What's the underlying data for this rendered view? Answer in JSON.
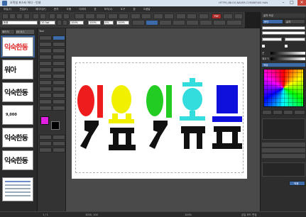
{
  "titlebar": {
    "title": "오락실 포스터 하다 - 인쇄",
    "url": "HTTPS://BLOG.NAVER.COM/INFIXIS HAN",
    "min": "–",
    "max": "□",
    "close": "×"
  },
  "menu": [
    "파일(F)",
    "편집(E)",
    "페이지(P)",
    "문자",
    "도형",
    "이미지",
    "표",
    "보기(V)",
    "도구",
    "창",
    "도움말"
  ],
  "toolbar": {
    "font_name": "돋움",
    "font_size": "10.5pt",
    "zoom": "100%",
    "field_a": "100%",
    "field_b": "0%",
    "field_c": "100%",
    "pdf_label": "PDF"
  },
  "pages": {
    "label": "페이지",
    "tab": "A4 6:1",
    "thumb_1": "익숙한동",
    "thumb_2": "워아",
    "thumb_3": "익숙한동",
    "thumb_4": "익숙한동",
    "thumb_5": "9,000",
    "thumb_6": "익숙한동"
  },
  "tools": {
    "label": "Tool"
  },
  "canvas": {
    "letters": [
      {
        "top": "이",
        "bottom": "ㅈ",
        "color": "#ee1c1c"
      },
      {
        "top": "요",
        "bottom": "ㅍ",
        "color": "#f0f000"
      },
      {
        "top": "이",
        "bottom": "ㅈ",
        "color": "#22cc22"
      },
      {
        "top": "호",
        "bottom": "ㅠ",
        "color": "#33dddd"
      },
      {
        "top": "므",
        "bottom": "ㅍ",
        "color": "#1010dd"
      }
    ]
  },
  "rpanel": {
    "header": "글자 속성",
    "tab_a": "문단",
    "tab_b": "글자",
    "color_label": "색상",
    "line_label": "선",
    "fill_label": "채우기",
    "apply": "적용"
  },
  "status": {
    "page": "1 / 1",
    "coords": "1000, 100",
    "zoom": "100%",
    "mode": "삽입 모드 편집"
  }
}
